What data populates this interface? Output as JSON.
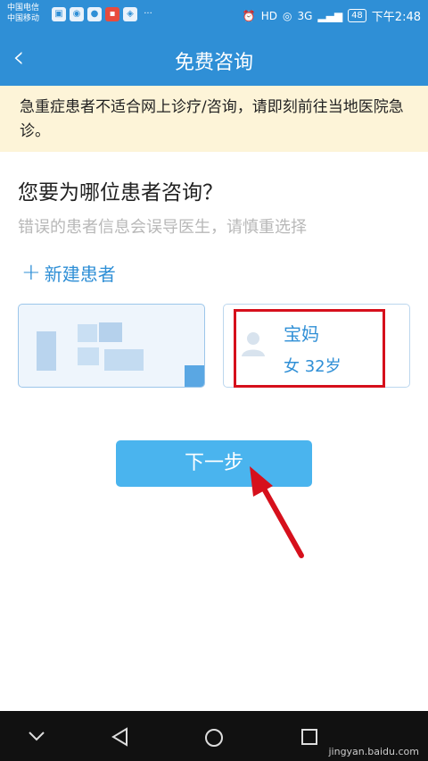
{
  "status_bar": {
    "carrier_1": "中国电信",
    "carrier_2": "中国移动",
    "network_label": "HD",
    "signal_label": "3G",
    "battery": "48",
    "time": "下午2:48"
  },
  "header": {
    "title": "免费咨询"
  },
  "warning_text": "急重症患者不适合网上诊疗/咨询，请即刻前往当地医院急诊。",
  "patient_section": {
    "question": "您要为哪位患者咨询？",
    "hint": "错误的患者信息会误导医生，请慎重选择",
    "add_patient_label": "新建患者"
  },
  "patients": [
    {
      "name": "宝妈",
      "info": "女 32岁"
    }
  ],
  "next_button": "下一步",
  "watermark": "jingyan.baidu.com"
}
